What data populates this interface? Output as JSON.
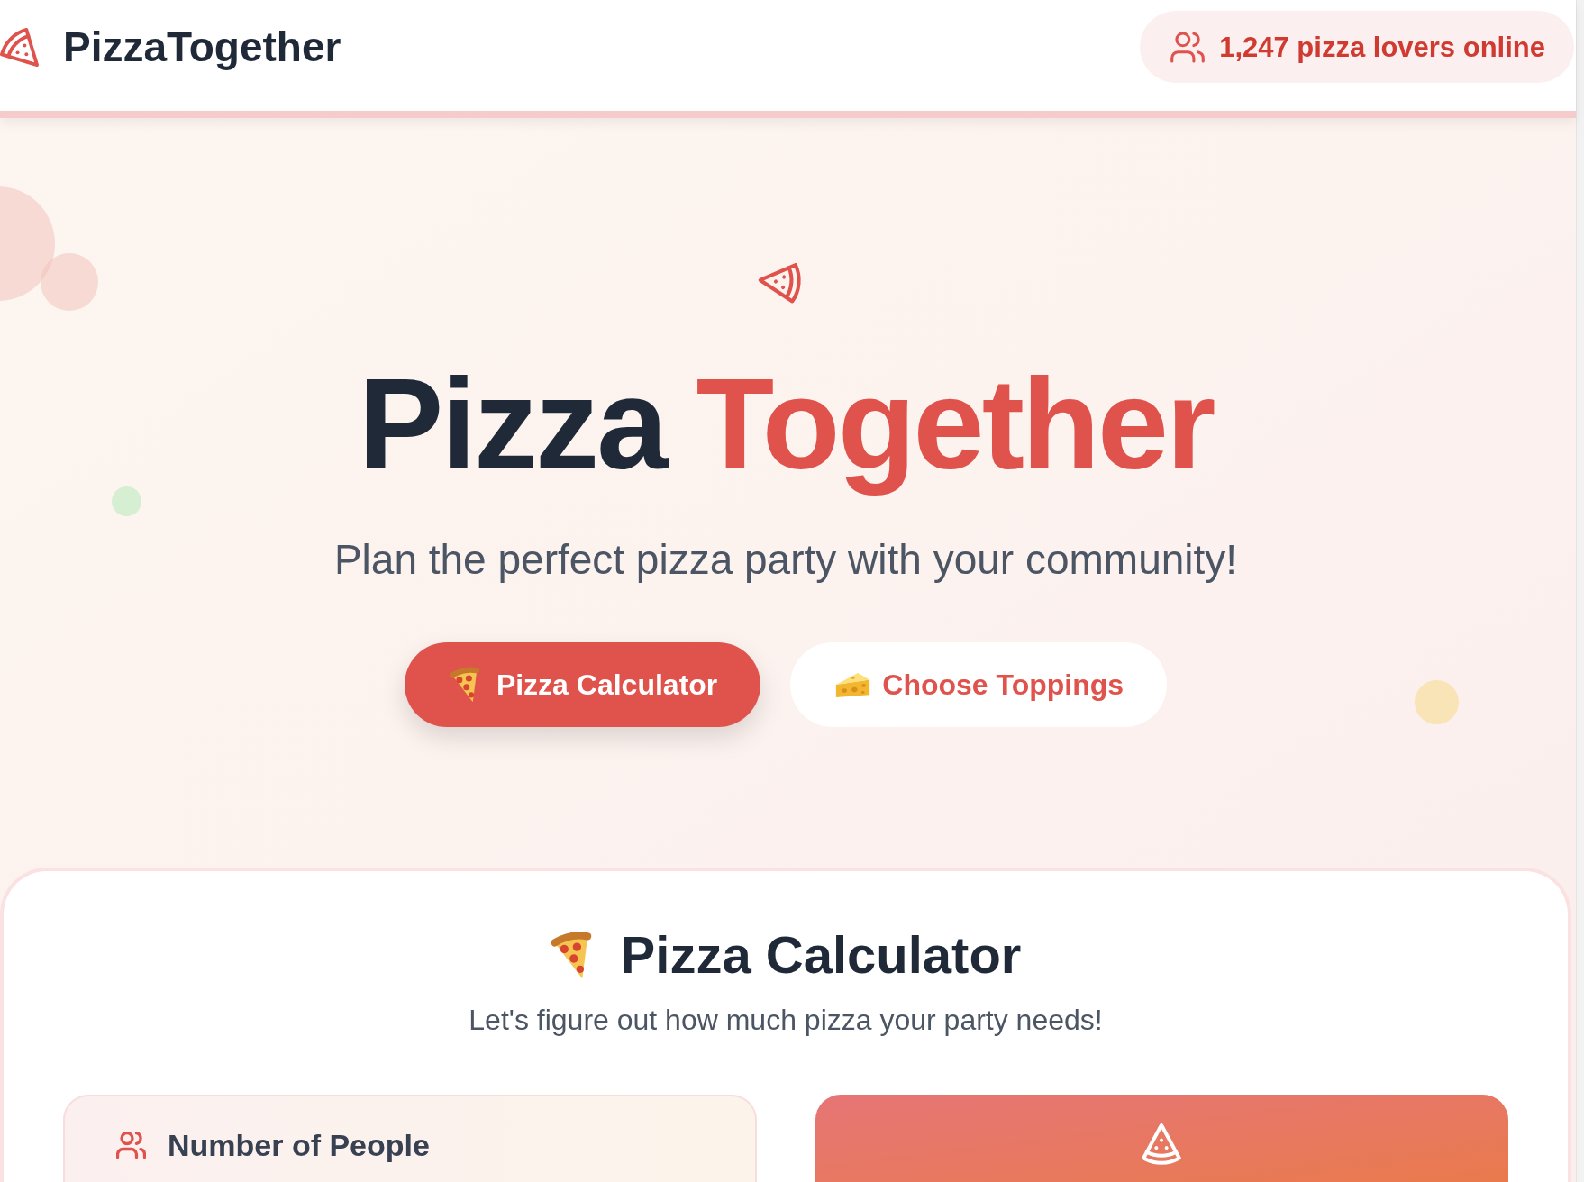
{
  "header": {
    "brand": "PizzaTogether",
    "online_badge": "1,247 pizza lovers online"
  },
  "hero": {
    "title_lead": "Pizza",
    "title_accent": "Together",
    "subtitle": "Plan the perfect pizza party with your community!",
    "buttons": [
      {
        "label": "Pizza Calculator",
        "kind": "primary"
      },
      {
        "label": "Choose Toppings",
        "kind": "secondary"
      }
    ]
  },
  "calculator": {
    "title": "Pizza Calculator",
    "subtitle": "Let's figure out how much pizza your party needs!",
    "people_label": "Number of People"
  }
}
